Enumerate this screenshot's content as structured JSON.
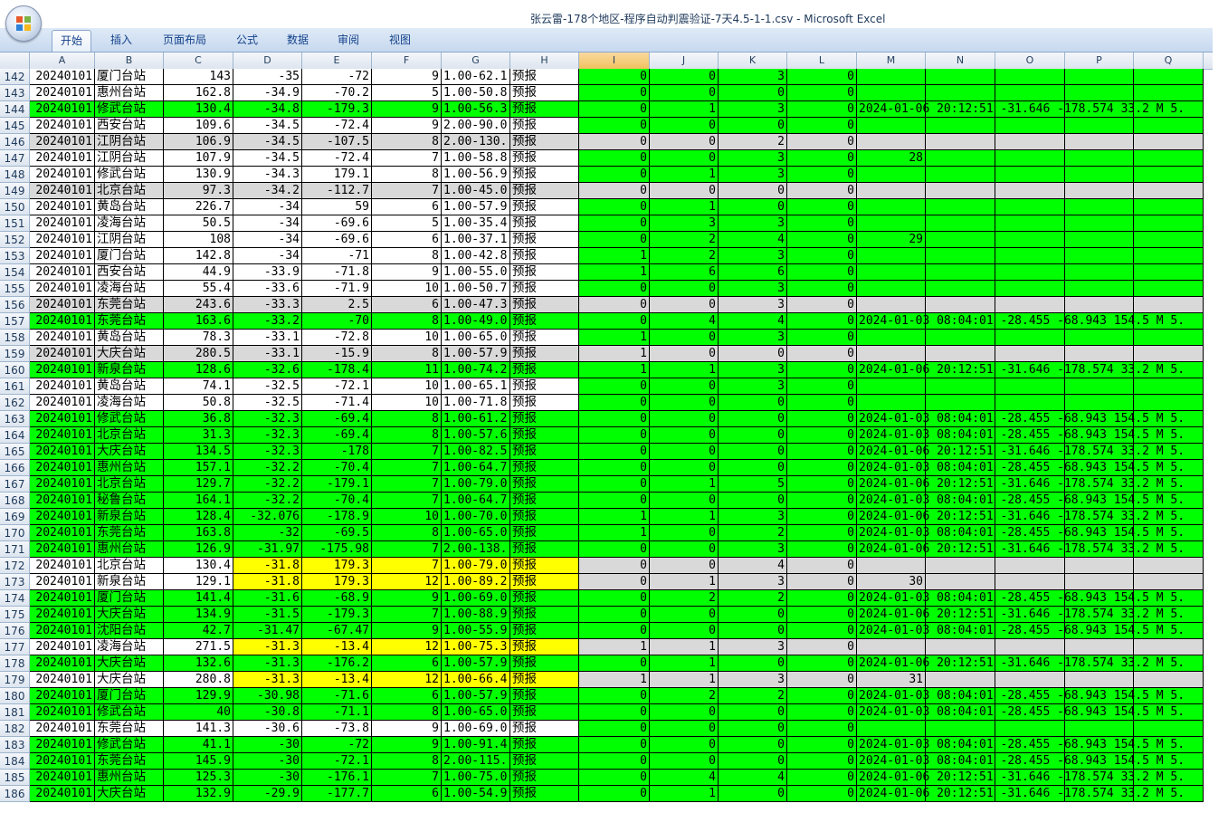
{
  "window_title": "张云雷-178个地区-程序自动判震验证-7天4.5-1-1.csv - Microsoft Excel",
  "ribbon_tabs": [
    "开始",
    "插入",
    "页面布局",
    "公式",
    "数据",
    "审阅",
    "视图"
  ],
  "active_tab": "开始",
  "columns": [
    "A",
    "B",
    "C",
    "D",
    "E",
    "F",
    "G",
    "H",
    "I",
    "J",
    "K",
    "L",
    "M",
    "N",
    "O",
    "P",
    "Q"
  ],
  "selected_column": "I",
  "colors": {
    "green": "#00ff00",
    "gray": "#d9d9d9",
    "yellow": "#ffff00",
    "white": "#ffffff"
  },
  "rows": [
    {
      "n": "142",
      "a": "20240101",
      "b": "厦门台站",
      "c": "143",
      "d": "-35",
      "e": "-72",
      "f": "9",
      "g": "1.00-62.1",
      "h": "预报",
      "i": "0",
      "j": "0",
      "k": "3",
      "l": "0",
      "m": "",
      "style": "wwwwwwwwg",
      "ml": "g"
    },
    {
      "n": "143",
      "a": "20240101",
      "b": "惠州台站",
      "c": "162.8",
      "d": "-34.9",
      "e": "-70.2",
      "f": "5",
      "g": "1.00-50.8",
      "h": "预报",
      "i": "0",
      "j": "0",
      "k": "0",
      "l": "0",
      "m": "",
      "style": "wwwwwwwwg",
      "ml": "g"
    },
    {
      "n": "144",
      "a": "20240101",
      "b": "修武台站",
      "c": "130.4",
      "d": "-34.8",
      "e": "-179.3",
      "f": "9",
      "g": "1.00-56.3",
      "h": "预报",
      "i": "0",
      "j": "1",
      "k": "3",
      "l": "0",
      "m": "2024-01-06 20:12:51 -31.646 -178.574 33.2 M 5.",
      "style": "ggggggggg",
      "ml": "g"
    },
    {
      "n": "145",
      "a": "20240101",
      "b": "西安台站",
      "c": "109.6",
      "d": "-34.5",
      "e": "-72.4",
      "f": "9",
      "g": "2.00-90.0",
      "h": "预报",
      "i": "0",
      "j": "0",
      "k": "0",
      "l": "0",
      "m": "",
      "style": "wwwwwwwwg",
      "ml": "g"
    },
    {
      "n": "146",
      "a": "20240101",
      "b": "江阴台站",
      "c": "106.9",
      "d": "-34.5",
      "e": "-107.5",
      "f": "8",
      "g": "2.00-130.",
      "h": "预报",
      "i": "0",
      "j": "0",
      "k": "2",
      "l": "0",
      "m": "",
      "style": "xxxxxxxxx",
      "ml": "x"
    },
    {
      "n": "147",
      "a": "20240101",
      "b": "江阴台站",
      "c": "107.9",
      "d": "-34.5",
      "e": "-72.4",
      "f": "7",
      "g": "1.00-58.8",
      "h": "预报",
      "i": "0",
      "j": "0",
      "k": "3",
      "l": "0",
      "m": "28",
      "style": "wwwwwwwwg",
      "ml": "g"
    },
    {
      "n": "148",
      "a": "20240101",
      "b": "修武台站",
      "c": "130.9",
      "d": "-34.3",
      "e": "179.1",
      "f": "8",
      "g": "1.00-56.9",
      "h": "预报",
      "i": "0",
      "j": "1",
      "k": "3",
      "l": "0",
      "m": "",
      "style": "wwwwwwwwg",
      "ml": "g"
    },
    {
      "n": "149",
      "a": "20240101",
      "b": "北京台站",
      "c": "97.3",
      "d": "-34.2",
      "e": "-112.7",
      "f": "7",
      "g": "1.00-45.0",
      "h": "预报",
      "i": "0",
      "j": "0",
      "k": "0",
      "l": "0",
      "m": "",
      "style": "xxxxxxxxx",
      "ml": "x"
    },
    {
      "n": "150",
      "a": "20240101",
      "b": "黄岛台站",
      "c": "226.7",
      "d": "-34",
      "e": "59",
      "f": "6",
      "g": "1.00-57.9",
      "h": "预报",
      "i": "0",
      "j": "1",
      "k": "0",
      "l": "0",
      "m": "",
      "style": "wwwwwwwwg",
      "ml": "g"
    },
    {
      "n": "151",
      "a": "20240101",
      "b": "凌海台站",
      "c": "50.5",
      "d": "-34",
      "e": "-69.6",
      "f": "5",
      "g": "1.00-35.4",
      "h": "预报",
      "i": "0",
      "j": "3",
      "k": "3",
      "l": "0",
      "m": "",
      "style": "wwwwwwwwg",
      "ml": "g"
    },
    {
      "n": "152",
      "a": "20240101",
      "b": "江阴台站",
      "c": "108",
      "d": "-34",
      "e": "-69.6",
      "f": "6",
      "g": "1.00-37.1",
      "h": "预报",
      "i": "0",
      "j": "2",
      "k": "4",
      "l": "0",
      "m": "29",
      "style": "wwwwwwwwg",
      "ml": "g"
    },
    {
      "n": "153",
      "a": "20240101",
      "b": "厦门台站",
      "c": "142.8",
      "d": "-34",
      "e": "-71",
      "f": "8",
      "g": "1.00-42.8",
      "h": "预报",
      "i": "1",
      "j": "2",
      "k": "3",
      "l": "0",
      "m": "",
      "style": "wwwwwwwwg",
      "ml": "g"
    },
    {
      "n": "154",
      "a": "20240101",
      "b": "西安台站",
      "c": "44.9",
      "d": "-33.9",
      "e": "-71.8",
      "f": "9",
      "g": "1.00-55.0",
      "h": "预报",
      "i": "1",
      "j": "6",
      "k": "6",
      "l": "0",
      "m": "",
      "style": "wwwwwwwwg",
      "ml": "g"
    },
    {
      "n": "155",
      "a": "20240101",
      "b": "凌海台站",
      "c": "55.4",
      "d": "-33.6",
      "e": "-71.9",
      "f": "10",
      "g": "1.00-50.7",
      "h": "预报",
      "i": "0",
      "j": "0",
      "k": "3",
      "l": "0",
      "m": "",
      "style": "wwwwwwwwg",
      "ml": "g"
    },
    {
      "n": "156",
      "a": "20240101",
      "b": "东莞台站",
      "c": "243.6",
      "d": "-33.3",
      "e": "2.5",
      "f": "6",
      "g": "1.00-47.3",
      "h": "预报",
      "i": "0",
      "j": "0",
      "k": "3",
      "l": "0",
      "m": "",
      "style": "xxxxxxxxx",
      "ml": "x"
    },
    {
      "n": "157",
      "a": "20240101",
      "b": "东莞台站",
      "c": "163.6",
      "d": "-33.2",
      "e": "-70",
      "f": "8",
      "g": "1.00-49.0",
      "h": "预报",
      "i": "0",
      "j": "4",
      "k": "4",
      "l": "0",
      "m": "2024-01-03 08:04:01 -28.455 -68.943 154.5 M 5.",
      "style": "ggggggggg",
      "ml": "g"
    },
    {
      "n": "158",
      "a": "20240101",
      "b": "黄岛台站",
      "c": "78.3",
      "d": "-33.1",
      "e": "-72.8",
      "f": "10",
      "g": "1.00-65.0",
      "h": "预报",
      "i": "1",
      "j": "0",
      "k": "3",
      "l": "0",
      "m": "",
      "style": "wwwwwwwwg",
      "ml": "g"
    },
    {
      "n": "159",
      "a": "20240101",
      "b": "大庆台站",
      "c": "280.5",
      "d": "-33.1",
      "e": "-15.9",
      "f": "8",
      "g": "1.00-57.9",
      "h": "预报",
      "i": "1",
      "j": "0",
      "k": "0",
      "l": "0",
      "m": "",
      "style": "xxxxxxxxx",
      "ml": "x"
    },
    {
      "n": "160",
      "a": "20240101",
      "b": "新泉台站",
      "c": "128.6",
      "d": "-32.6",
      "e": "-178.4",
      "f": "11",
      "g": "1.00-74.2",
      "h": "预报",
      "i": "1",
      "j": "1",
      "k": "3",
      "l": "0",
      "m": "2024-01-06 20:12:51 -31.646 -178.574 33.2 M 5.",
      "style": "ggggggggg",
      "ml": "g"
    },
    {
      "n": "161",
      "a": "20240101",
      "b": "黄岛台站",
      "c": "74.1",
      "d": "-32.5",
      "e": "-72.1",
      "f": "10",
      "g": "1.00-65.1",
      "h": "预报",
      "i": "0",
      "j": "0",
      "k": "3",
      "l": "0",
      "m": "",
      "style": "wwwwwwwwg",
      "ml": "g"
    },
    {
      "n": "162",
      "a": "20240101",
      "b": "凌海台站",
      "c": "50.8",
      "d": "-32.5",
      "e": "-71.4",
      "f": "10",
      "g": "1.00-71.8",
      "h": "预报",
      "i": "0",
      "j": "0",
      "k": "0",
      "l": "0",
      "m": "",
      "style": "wwwwwwwwg",
      "ml": "g"
    },
    {
      "n": "163",
      "a": "20240101",
      "b": "修武台站",
      "c": "36.8",
      "d": "-32.3",
      "e": "-69.4",
      "f": "8",
      "g": "1.00-61.2",
      "h": "预报",
      "i": "0",
      "j": "0",
      "k": "0",
      "l": "0",
      "m": "2024-01-03 08:04:01 -28.455 -68.943 154.5 M 5.",
      "style": "ggggggggg",
      "ml": "g"
    },
    {
      "n": "164",
      "a": "20240101",
      "b": "北京台站",
      "c": "31.3",
      "d": "-32.3",
      "e": "-69.4",
      "f": "8",
      "g": "1.00-57.6",
      "h": "预报",
      "i": "0",
      "j": "0",
      "k": "0",
      "l": "0",
      "m": "2024-01-03 08:04:01 -28.455 -68.943 154.5 M 5.",
      "style": "ggggggggg",
      "ml": "g"
    },
    {
      "n": "165",
      "a": "20240101",
      "b": "大庆台站",
      "c": "134.5",
      "d": "-32.3",
      "e": "-178",
      "f": "7",
      "g": "1.00-82.5",
      "h": "预报",
      "i": "0",
      "j": "0",
      "k": "0",
      "l": "0",
      "m": "2024-01-06 20:12:51 -31.646 -178.574 33.2 M 5.",
      "style": "ggggggggg",
      "ml": "g"
    },
    {
      "n": "166",
      "a": "20240101",
      "b": "惠州台站",
      "c": "157.1",
      "d": "-32.2",
      "e": "-70.4",
      "f": "7",
      "g": "1.00-64.7",
      "h": "预报",
      "i": "0",
      "j": "0",
      "k": "0",
      "l": "0",
      "m": "2024-01-03 08:04:01 -28.455 -68.943 154.5 M 5.",
      "style": "ggggggggg",
      "ml": "g"
    },
    {
      "n": "167",
      "a": "20240101",
      "b": "北京台站",
      "c": "129.7",
      "d": "-32.2",
      "e": "-179.1",
      "f": "7",
      "g": "1.00-79.0",
      "h": "预报",
      "i": "0",
      "j": "1",
      "k": "5",
      "l": "0",
      "m": "2024-01-06 20:12:51 -31.646 -178.574 33.2 M 5.",
      "style": "ggggggggg",
      "ml": "g"
    },
    {
      "n": "168",
      "a": "20240101",
      "b": "秘鲁台站",
      "c": "164.1",
      "d": "-32.2",
      "e": "-70.4",
      "f": "7",
      "g": "1.00-64.7",
      "h": "预报",
      "i": "0",
      "j": "0",
      "k": "0",
      "l": "0",
      "m": "2024-01-03 08:04:01 -28.455 -68.943 154.5 M 5.",
      "style": "ggggggggg",
      "ml": "g"
    },
    {
      "n": "169",
      "a": "20240101",
      "b": "新泉台站",
      "c": "128.4",
      "d": "-32.076",
      "e": "-178.9",
      "f": "10",
      "g": "1.00-70.0",
      "h": "预报",
      "i": "1",
      "j": "1",
      "k": "3",
      "l": "0",
      "m": "2024-01-06 20:12:51 -31.646 -178.574 33.2 M 5.",
      "style": "ggggggggg",
      "ml": "g"
    },
    {
      "n": "170",
      "a": "20240101",
      "b": "东莞台站",
      "c": "163.8",
      "d": "-32",
      "e": "-69.5",
      "f": "8",
      "g": "1.00-65.0",
      "h": "预报",
      "i": "1",
      "j": "0",
      "k": "2",
      "l": "0",
      "m": "2024-01-03 08:04:01 -28.455 -68.943 154.5 M 5.",
      "style": "ggggggggg",
      "ml": "g"
    },
    {
      "n": "171",
      "a": "20240101",
      "b": "惠州台站",
      "c": "126.9",
      "d": "-31.97",
      "e": "-175.98",
      "f": "7",
      "g": "2.00-138.",
      "h": "预报",
      "i": "0",
      "j": "0",
      "k": "3",
      "l": "0",
      "m": "2024-01-06 20:12:51 -31.646 -178.574 33.2 M 5.",
      "style": "ggggggggg",
      "ml": "g"
    },
    {
      "n": "172",
      "a": "20240101",
      "b": "北京台站",
      "c": "130.4",
      "d": "-31.8",
      "e": "179.3",
      "f": "7",
      "g": "1.00-79.0",
      "h": "预报",
      "i": "0",
      "j": "0",
      "k": "4",
      "l": "0",
      "m": "",
      "style": "wwwyyyyyx",
      "ml": "x"
    },
    {
      "n": "173",
      "a": "20240101",
      "b": "新泉台站",
      "c": "129.1",
      "d": "-31.8",
      "e": "179.3",
      "f": "12",
      "g": "1.00-89.2",
      "h": "预报",
      "i": "0",
      "j": "1",
      "k": "3",
      "l": "0",
      "m": "30",
      "style": "wwwyyyyyx",
      "ml": "x"
    },
    {
      "n": "174",
      "a": "20240101",
      "b": "厦门台站",
      "c": "141.4",
      "d": "-31.6",
      "e": "-68.9",
      "f": "9",
      "g": "1.00-69.0",
      "h": "预报",
      "i": "0",
      "j": "2",
      "k": "2",
      "l": "0",
      "m": "2024-01-03 08:04:01 -28.455 -68.943 154.5 M 5.",
      "style": "ggggggggg",
      "ml": "g"
    },
    {
      "n": "175",
      "a": "20240101",
      "b": "大庆台站",
      "c": "134.9",
      "d": "-31.5",
      "e": "-179.3",
      "f": "7",
      "g": "1.00-88.9",
      "h": "预报",
      "i": "0",
      "j": "0",
      "k": "0",
      "l": "0",
      "m": "2024-01-06 20:12:51 -31.646 -178.574 33.2 M 5.",
      "style": "ggggggggg",
      "ml": "g"
    },
    {
      "n": "176",
      "a": "20240101",
      "b": "沈阳台站",
      "c": "42.7",
      "d": "-31.47",
      "e": "-67.47",
      "f": "9",
      "g": "1.00-55.9",
      "h": "预报",
      "i": "0",
      "j": "0",
      "k": "0",
      "l": "0",
      "m": "2024-01-03 08:04:01 -28.455 -68.943 154.5 M 5.",
      "style": "ggggggggg",
      "ml": "g"
    },
    {
      "n": "177",
      "a": "20240101",
      "b": "凌海台站",
      "c": "271.5",
      "d": "-31.3",
      "e": "-13.4",
      "f": "12",
      "g": "1.00-75.3",
      "h": "预报",
      "i": "1",
      "j": "1",
      "k": "3",
      "l": "0",
      "m": "",
      "style": "wwwyyyyyx",
      "ml": "x"
    },
    {
      "n": "178",
      "a": "20240101",
      "b": "大庆台站",
      "c": "132.6",
      "d": "-31.3",
      "e": "-176.2",
      "f": "6",
      "g": "1.00-57.9",
      "h": "预报",
      "i": "0",
      "j": "1",
      "k": "0",
      "l": "0",
      "m": "2024-01-06 20:12:51 -31.646 -178.574 33.2 M 5.",
      "style": "ggggggggg",
      "ml": "g"
    },
    {
      "n": "179",
      "a": "20240101",
      "b": "大庆台站",
      "c": "280.8",
      "d": "-31.3",
      "e": "-13.4",
      "f": "12",
      "g": "1.00-66.4",
      "h": "预报",
      "i": "1",
      "j": "1",
      "k": "3",
      "l": "0",
      "m": "31",
      "style": "wwwyyyyyx",
      "ml": "x"
    },
    {
      "n": "180",
      "a": "20240101",
      "b": "厦门台站",
      "c": "129.9",
      "d": "-30.98",
      "e": "-71.6",
      "f": "6",
      "g": "1.00-57.9",
      "h": "预报",
      "i": "0",
      "j": "2",
      "k": "2",
      "l": "0",
      "m": "2024-01-03 08:04:01 -28.455 -68.943 154.5 M 5.",
      "style": "ggggggggg",
      "ml": "g"
    },
    {
      "n": "181",
      "a": "20240101",
      "b": "修武台站",
      "c": "40",
      "d": "-30.8",
      "e": "-71.1",
      "f": "8",
      "g": "1.00-65.0",
      "h": "预报",
      "i": "0",
      "j": "0",
      "k": "0",
      "l": "0",
      "m": "2024-01-03 08:04:01 -28.455 -68.943 154.5 M 5.",
      "style": "ggggggggg",
      "ml": "g"
    },
    {
      "n": "182",
      "a": "20240101",
      "b": "东莞台站",
      "c": "141.3",
      "d": "-30.6",
      "e": "-73.8",
      "f": "9",
      "g": "1.00-69.0",
      "h": "预报",
      "i": "0",
      "j": "0",
      "k": "0",
      "l": "0",
      "m": "",
      "style": "wwwwwwwwg",
      "ml": "g"
    },
    {
      "n": "183",
      "a": "20240101",
      "b": "修武台站",
      "c": "41.1",
      "d": "-30",
      "e": "-72",
      "f": "9",
      "g": "1.00-91.4",
      "h": "预报",
      "i": "0",
      "j": "0",
      "k": "0",
      "l": "0",
      "m": "2024-01-03 08:04:01 -28.455 -68.943 154.5 M 5.",
      "style": "ggggggggg",
      "ml": "g"
    },
    {
      "n": "184",
      "a": "20240101",
      "b": "东莞台站",
      "c": "145.9",
      "d": "-30",
      "e": "-72.1",
      "f": "8",
      "g": "2.00-115.",
      "h": "预报",
      "i": "0",
      "j": "0",
      "k": "0",
      "l": "0",
      "m": "2024-01-03 08:04:01 -28.455 -68.943 154.5 M 5.",
      "style": "ggggggggg",
      "ml": "g"
    },
    {
      "n": "185",
      "a": "20240101",
      "b": "惠州台站",
      "c": "125.3",
      "d": "-30",
      "e": "-176.1",
      "f": "7",
      "g": "1.00-75.0",
      "h": "预报",
      "i": "0",
      "j": "4",
      "k": "4",
      "l": "0",
      "m": "2024-01-06 20:12:51 -31.646 -178.574 33.2 M 5.",
      "style": "ggggggggg",
      "ml": "g"
    },
    {
      "n": "186",
      "a": "20240101",
      "b": "大庆台站",
      "c": "132.9",
      "d": "-29.9",
      "e": "-177.7",
      "f": "6",
      "g": "1.00-54.9",
      "h": "预报",
      "i": "0",
      "j": "1",
      "k": "0",
      "l": "0",
      "m": "2024-01-06 20:12:51 -31.646 -178.574 33.2 M 5.",
      "style": "ggggggggg",
      "ml": "g"
    }
  ]
}
